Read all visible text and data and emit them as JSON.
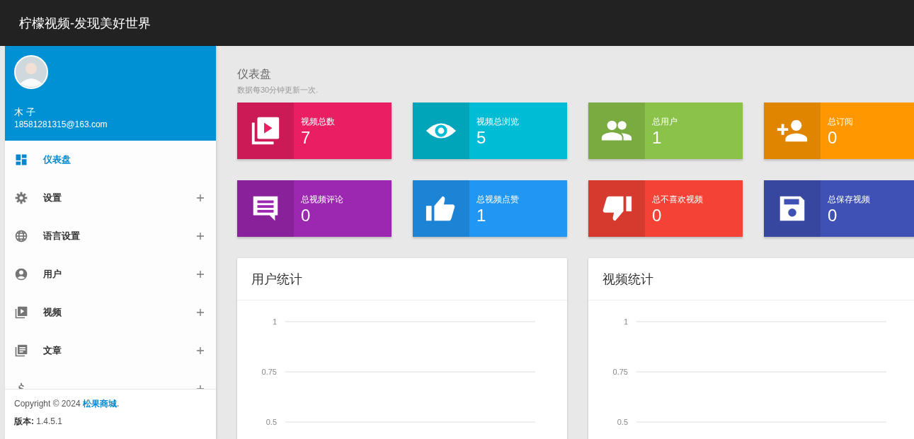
{
  "header": {
    "title": "柠檬视频-发现美好世界"
  },
  "profile": {
    "name": "木 子",
    "email": "18581281315@163.com"
  },
  "menu": [
    {
      "kind": "dashboard",
      "label": "仪表盘",
      "selected": true,
      "expandable": false
    },
    {
      "kind": "gear",
      "label": "设置",
      "selected": false,
      "expandable": true
    },
    {
      "kind": "globe",
      "label": "语言设置",
      "selected": false,
      "expandable": true
    },
    {
      "kind": "person",
      "label": "用户",
      "selected": false,
      "expandable": true
    },
    {
      "kind": "video",
      "label": "视频",
      "selected": false,
      "expandable": true
    },
    {
      "kind": "article",
      "label": "文章",
      "selected": false,
      "expandable": true
    },
    {
      "kind": "dollar",
      "expandable": true
    }
  ],
  "footer": {
    "copyright": "Copyright © 2024",
    "link": "松果商城",
    "link_end": ".",
    "version_label": "版本:",
    "version": "1.4.5.1"
  },
  "page": {
    "title": "仪表盘",
    "subtitle": "数据每30分钟更新一次."
  },
  "stats": [
    {
      "kind": "video",
      "label": "视频总数",
      "value": "7",
      "color": "#e91e63"
    },
    {
      "kind": "eye",
      "label": "视频总浏览",
      "value": "5",
      "color": "#00bcd4"
    },
    {
      "kind": "people",
      "label": "总用户",
      "value": "1",
      "color": "#8bc34a"
    },
    {
      "kind": "addperson",
      "label": "总订阅",
      "value": "0",
      "color": "#ff9800"
    },
    {
      "kind": "comment",
      "label": "总视频评论",
      "value": "0",
      "color": "#9c27b0"
    },
    {
      "kind": "thumbup",
      "label": "总视频点赞",
      "value": "1",
      "color": "#2196f3"
    },
    {
      "kind": "thumbdown",
      "label": "总不喜欢视频",
      "value": "0",
      "color": "#f44336"
    },
    {
      "kind": "save",
      "label": "总保存视频",
      "value": "0",
      "color": "#3f51b5"
    }
  ],
  "panels": [
    {
      "title": "用户统计",
      "axis_labels": [
        "1",
        "0.75",
        "0.5"
      ]
    },
    {
      "title": "视频统计",
      "axis_labels": [
        "1",
        "0.75",
        "0.5"
      ]
    }
  ]
}
